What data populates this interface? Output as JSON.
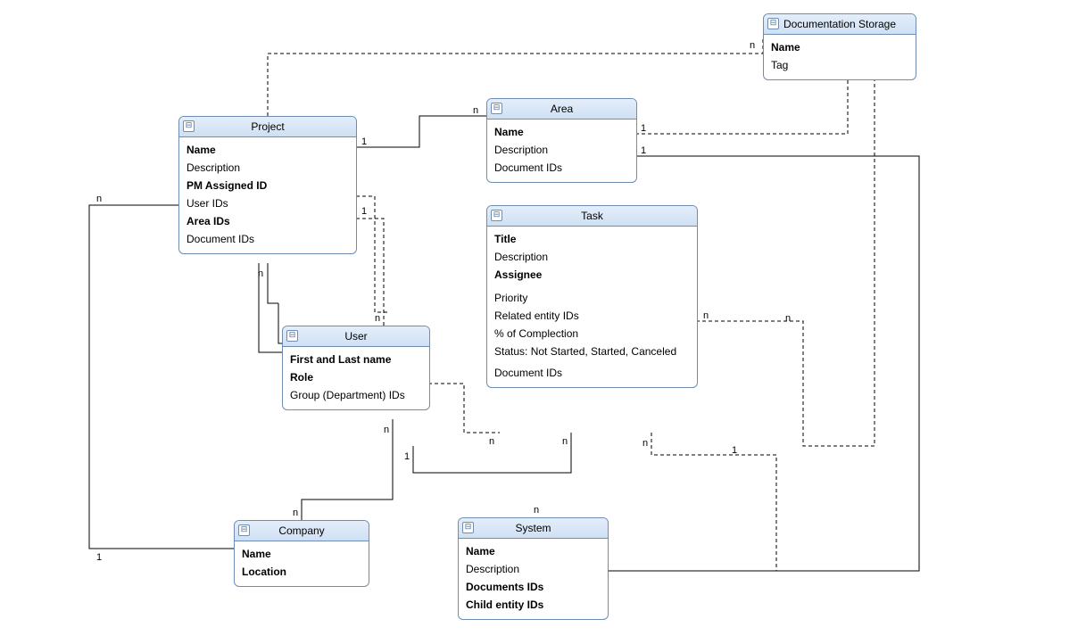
{
  "entities": {
    "docstorage": {
      "title": "Documentation Storage",
      "attrs": [
        {
          "label": "Name",
          "bold": true
        },
        {
          "label": "Tag",
          "bold": false
        }
      ]
    },
    "project": {
      "title": "Project",
      "attrs": [
        {
          "label": "Name",
          "bold": true
        },
        {
          "label": "Description",
          "bold": false
        },
        {
          "label": "PM Assigned ID",
          "bold": true
        },
        {
          "label": "User IDs",
          "bold": false
        },
        {
          "label": "Area IDs",
          "bold": true
        },
        {
          "label": "Document IDs",
          "bold": false
        }
      ]
    },
    "area": {
      "title": "Area",
      "attrs": [
        {
          "label": "Name",
          "bold": true
        },
        {
          "label": "Description",
          "bold": false
        },
        {
          "label": "Document IDs",
          "bold": false
        }
      ]
    },
    "task": {
      "title": "Task",
      "attrs": [
        {
          "label": "Title",
          "bold": true
        },
        {
          "label": "Description",
          "bold": false
        },
        {
          "label": "Assignee",
          "bold": true
        },
        {
          "label": "Priority",
          "bold": false
        },
        {
          "label": "Related entity IDs",
          "bold": false
        },
        {
          "label": "% of Complection",
          "bold": false
        },
        {
          "label": "Status: Not Started, Started, Canceled",
          "bold": false
        },
        {
          "label": "Document IDs",
          "bold": false
        }
      ]
    },
    "user": {
      "title": "User",
      "attrs": [
        {
          "label": "First and Last name",
          "bold": true
        },
        {
          "label": "Role",
          "bold": true
        },
        {
          "label": "Group (Department) IDs",
          "bold": false
        }
      ]
    },
    "company": {
      "title": "Company",
      "attrs": [
        {
          "label": "Name",
          "bold": true
        },
        {
          "label": "Location",
          "bold": true
        }
      ]
    },
    "system": {
      "title": "System",
      "attrs": [
        {
          "label": "Name",
          "bold": true
        },
        {
          "label": "Description",
          "bold": false
        },
        {
          "label": "Documents IDs",
          "bold": true
        },
        {
          "label": "Child entity IDs",
          "bold": true
        }
      ]
    }
  },
  "cardinalities": {
    "one": "1",
    "many": "n"
  },
  "collapse_glyph": "⊟"
}
